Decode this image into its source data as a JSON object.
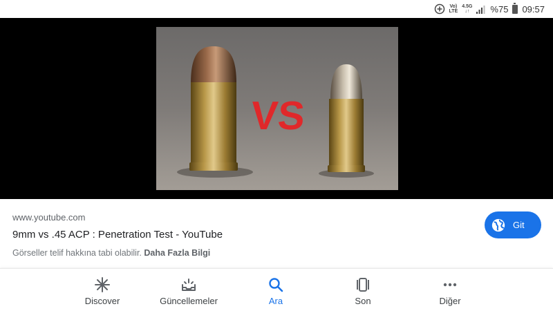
{
  "status_bar": {
    "network_top": "Vo)",
    "network_bottom": "LTE",
    "signal_top": "4.5G",
    "battery_text": "%75",
    "time": "09:57"
  },
  "result": {
    "domain": "www.youtube.com",
    "title": "9mm vs .45 ACP : Penetration Test - YouTube",
    "notice": "Görseller telif hakkına tabi olabilir.",
    "more_info": "Daha Fazla Bilgi",
    "go_label": "Git"
  },
  "image": {
    "vs_text": "VS"
  },
  "bottom_nav": {
    "active": "search",
    "items": [
      {
        "id": "discover",
        "label": "Discover",
        "icon": "asterisk-icon"
      },
      {
        "id": "updates",
        "label": "Güncellemeler",
        "icon": "inbox-updates-icon"
      },
      {
        "id": "search",
        "label": "Ara",
        "icon": "search-icon"
      },
      {
        "id": "recent",
        "label": "Son",
        "icon": "tabs-icon"
      },
      {
        "id": "more",
        "label": "Diğer",
        "icon": "more-dots-icon"
      }
    ]
  },
  "colors": {
    "accent": "#1a73e8",
    "vs_red": "#e0282a",
    "nav_icon": "#5f6368"
  }
}
